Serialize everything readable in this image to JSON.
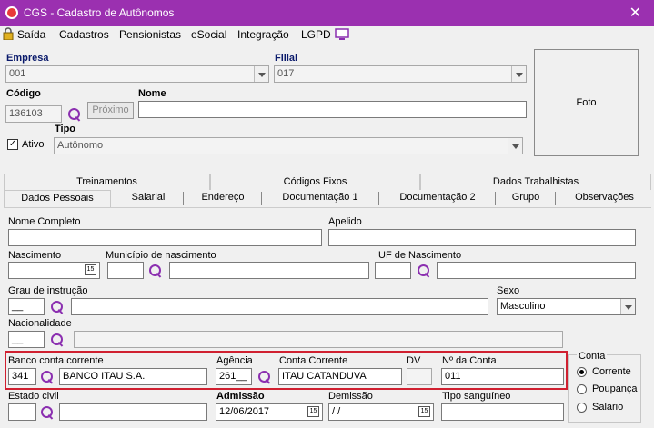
{
  "window": {
    "title": "CGS - Cadastro de Autônomos",
    "close": "✕"
  },
  "menu": [
    "Saída",
    "Cadastros",
    "Pensionistas",
    "eSocial",
    "Integração",
    "LGPD"
  ],
  "header": {
    "empresa_label": "Empresa",
    "empresa_value": "001",
    "filial_label": "Filial",
    "filial_value": "017",
    "codigo_label": "Código",
    "codigo_value": "136103",
    "proximo_label": "Próximo",
    "nome_label": "Nome",
    "nome_value": "",
    "ativo_label": "Ativo",
    "ativo_checked": true,
    "tipo_label": "Tipo",
    "tipo_value": "Autônomo",
    "foto_label": "Foto"
  },
  "tabs_row1": [
    "Treinamentos",
    "Códigos Fixos",
    "Dados Trabalhistas"
  ],
  "tabs_row2": [
    "Dados Pessoais",
    "Salarial",
    "Endereço",
    "Documentação 1",
    "Documentação 2",
    "Grupo",
    "Observações"
  ],
  "form": {
    "nome_completo_label": "Nome Completo",
    "apelido_label": "Apelido",
    "nascimento_label": "Nascimento",
    "municipio_label": "Município de nascimento",
    "uf_label": "UF de Nascimento",
    "grau_label": "Grau de instrução",
    "grau_value": "__",
    "sexo_label": "Sexo",
    "sexo_value": "Masculino",
    "nacionalidade_label": "Nacionalidade",
    "nacionalidade_value": "__",
    "banco_label": "Banco conta corrente",
    "banco_code": "341",
    "banco_name": "BANCO ITAU S.A.",
    "agencia_label": "Agência",
    "agencia_value": "261__",
    "conta_corrente_label": "Conta Corrente",
    "conta_corrente_value": "ITAU CATANDUVA",
    "dv_label": "DV",
    "numero_conta_label": "Nº da Conta",
    "numero_conta_value": "011",
    "conta_group_label": "Conta",
    "conta_options": [
      "Corrente",
      "Poupança",
      "Salário"
    ],
    "conta_selected": "Corrente",
    "estado_civil_label": "Estado civil",
    "admissao_label": "Admissão",
    "admissao_value": "12/06/2017",
    "demissao_label": "Demissão",
    "demissao_value": " / /",
    "tipo_sanguineo_label": "Tipo sanguíneo",
    "calendar_glyph": "15"
  }
}
